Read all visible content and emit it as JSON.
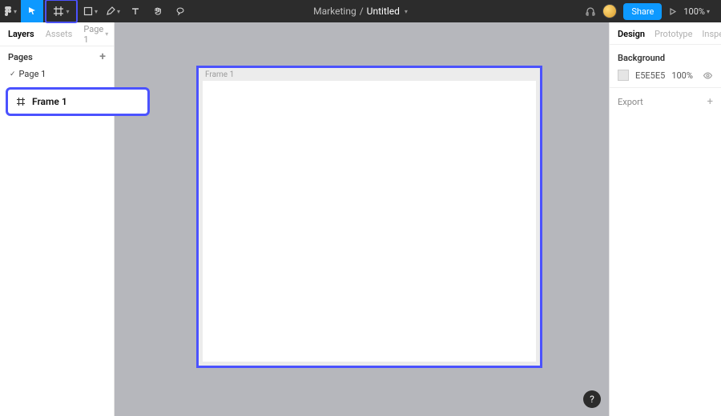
{
  "topbar": {
    "project": "Marketing",
    "separator": "/",
    "file": "Untitled",
    "share_label": "Share",
    "zoom": "100%"
  },
  "left_panel": {
    "tabs": {
      "layers": "Layers",
      "assets": "Assets"
    },
    "page_dropdown": "Page 1",
    "pages_header": "Pages",
    "pages": [
      "Page 1"
    ],
    "selected_layer": "Frame 1"
  },
  "canvas": {
    "frame_label": "Frame 1"
  },
  "right_panel": {
    "tabs": {
      "design": "Design",
      "prototype": "Prototype",
      "inspect": "Inspect"
    },
    "background": {
      "header": "Background",
      "hex": "E5E5E5",
      "opacity": "100%"
    },
    "export_label": "Export"
  },
  "help_label": "?"
}
